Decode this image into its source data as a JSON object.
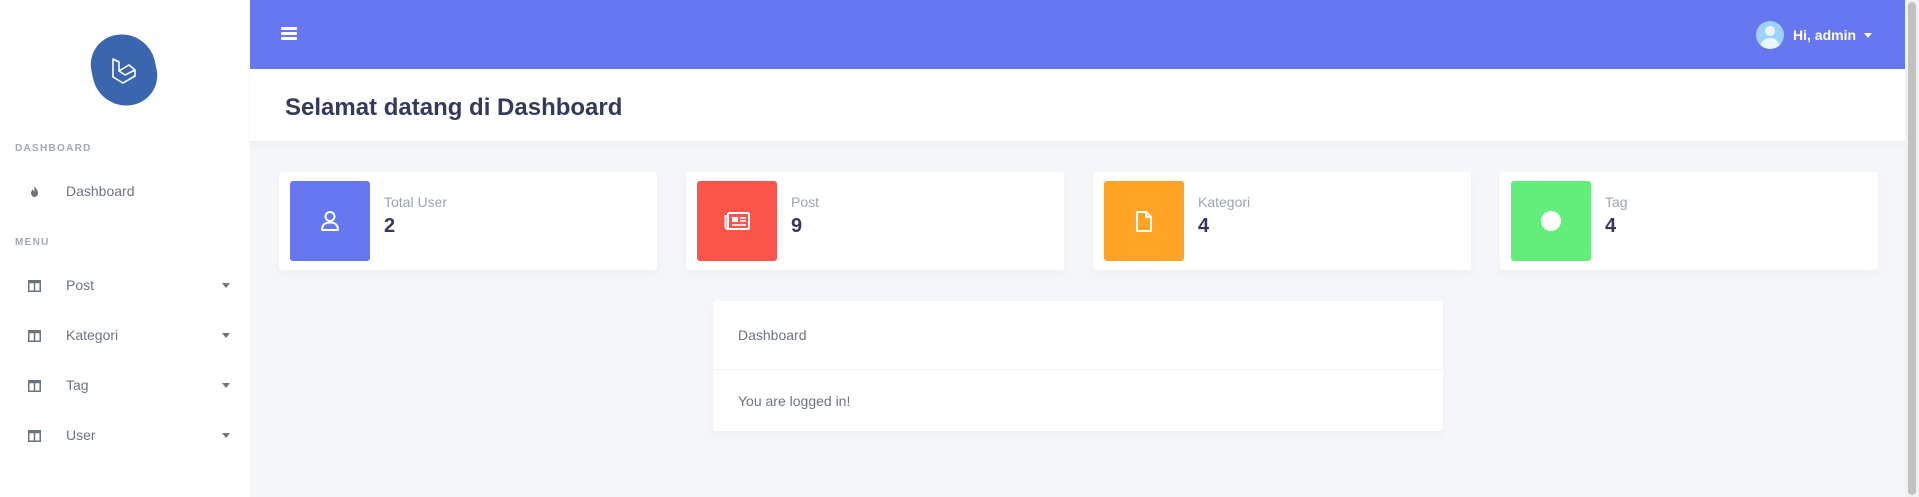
{
  "sidebar": {
    "logo_icon": "laravel-logo",
    "sections": [
      {
        "header": "DASHBOARD"
      },
      {
        "header": "MENU"
      }
    ],
    "items": [
      {
        "label": "Dashboard",
        "icon": "fire-icon",
        "has_caret": false
      },
      {
        "label": "Post",
        "icon": "columns-icon",
        "has_caret": true
      },
      {
        "label": "Kategori",
        "icon": "columns-icon",
        "has_caret": true
      },
      {
        "label": "Tag",
        "icon": "columns-icon",
        "has_caret": true
      },
      {
        "label": "User",
        "icon": "columns-icon",
        "has_caret": true
      }
    ]
  },
  "topbar": {
    "menu_icon": "hamburger-icon",
    "user_greeting": "Hi, admin",
    "colors": {
      "background": "#6777ef"
    }
  },
  "section": {
    "title": "Selamat datang di Dashboard"
  },
  "stats": [
    {
      "label": "Total User",
      "value": "2",
      "icon": "user-icon",
      "color": "#6777ef"
    },
    {
      "label": "Post",
      "value": "9",
      "icon": "newspaper-icon",
      "color": "#fc544b"
    },
    {
      "label": "Kategori",
      "value": "4",
      "icon": "file-icon",
      "color": "#ffa426"
    },
    {
      "label": "Tag",
      "value": "4",
      "icon": "circle-icon",
      "color": "#63ed7a"
    }
  ],
  "panel": {
    "title": "Dashboard",
    "message": "You are logged in!"
  }
}
